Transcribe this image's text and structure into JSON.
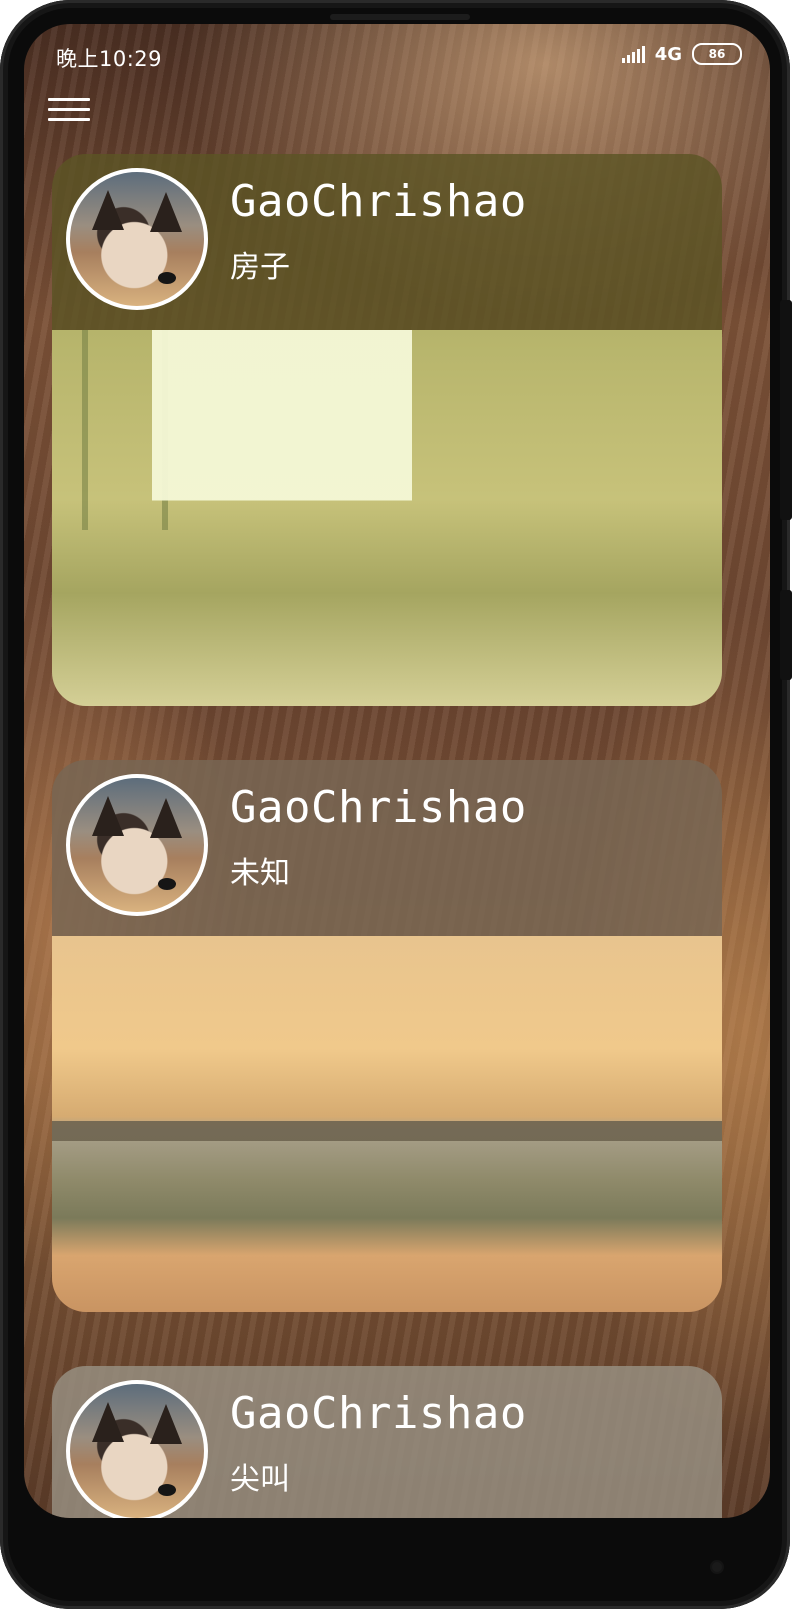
{
  "status_bar": {
    "time": "晚上10:29",
    "network": "4G",
    "battery": "86"
  },
  "toolbar": {
    "menu_icon": "hamburger-menu-icon"
  },
  "feed": {
    "posts": [
      {
        "username": "GaoChrishao",
        "caption": "房子",
        "image": "living-room-photo"
      },
      {
        "username": "GaoChrishao",
        "caption": "未知",
        "image": "sunset-bridge-photo"
      },
      {
        "username": "GaoChrishao",
        "caption": "尖叫",
        "image": "partially-visible-photo"
      }
    ]
  }
}
